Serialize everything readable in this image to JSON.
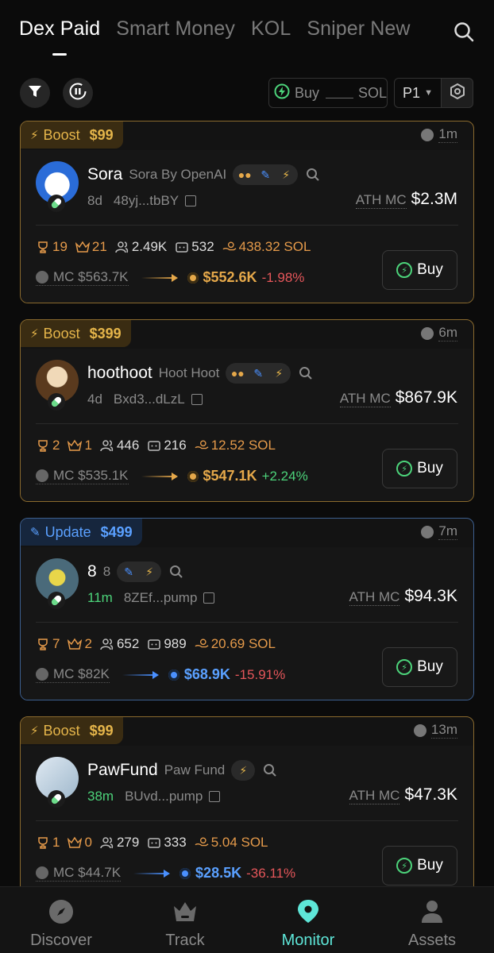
{
  "tabs": [
    {
      "label": "Dex Paid"
    },
    {
      "label": "Smart Money"
    },
    {
      "label": "KOL"
    },
    {
      "label": "Sniper New"
    }
  ],
  "toolbar": {
    "buy_label": "Buy",
    "sol_label": "SOL",
    "page_label": "P1"
  },
  "cards": [
    {
      "tag": "Boost",
      "tag_price": "$99",
      "age": "1m",
      "name": "Sora",
      "sub": "Sora By OpenAI",
      "token_age": "8d",
      "address": "48yj...tbBY",
      "ath_label": "ATH MC",
      "ath_value": "$2.3M",
      "stats": {
        "trophy": "19",
        "crown": "21",
        "holders": "2.49K",
        "bots": "532",
        "sol": "438.32 SOL"
      },
      "mc_label": "MC $563.7K",
      "mc_now": "$552.6K",
      "change": "-1.98%",
      "buy": "Buy"
    },
    {
      "tag": "Boost",
      "tag_price": "$399",
      "age": "6m",
      "name": "hoothoot",
      "sub": "Hoot Hoot",
      "token_age": "4d",
      "address": "Bxd3...dLzL",
      "ath_label": "ATH MC",
      "ath_value": "$867.9K",
      "stats": {
        "trophy": "2",
        "crown": "1",
        "holders": "446",
        "bots": "216",
        "sol": "12.52 SOL"
      },
      "mc_label": "MC $535.1K",
      "mc_now": "$547.1K",
      "change": "+2.24%",
      "buy": "Buy"
    },
    {
      "tag": "Update",
      "tag_price": "$499",
      "age": "7m",
      "name": "8",
      "sub": "8",
      "token_age": "11m",
      "address": "8ZEf...pump",
      "ath_label": "ATH MC",
      "ath_value": "$94.3K",
      "stats": {
        "trophy": "7",
        "crown": "2",
        "holders": "652",
        "bots": "989",
        "sol": "20.69 SOL"
      },
      "mc_label": "MC $82K",
      "mc_now": "$68.9K",
      "change": "-15.91%",
      "buy": "Buy"
    },
    {
      "tag": "Boost",
      "tag_price": "$99",
      "age": "13m",
      "name": "PawFund",
      "sub": "Paw Fund",
      "token_age": "38m",
      "address": "BUvd...pump",
      "ath_label": "ATH MC",
      "ath_value": "$47.3K",
      "stats": {
        "trophy": "1",
        "crown": "0",
        "holders": "279",
        "bots": "333",
        "sol": "5.04 SOL"
      },
      "mc_label": "MC $44.7K",
      "mc_now": "$28.5K",
      "change": "-36.11%",
      "buy": "Buy"
    }
  ],
  "bottom_nav": [
    {
      "label": "Discover",
      "icon": "compass-icon"
    },
    {
      "label": "Track",
      "icon": "crown-icon"
    },
    {
      "label": "Monitor",
      "icon": "location-pin-icon"
    },
    {
      "label": "Assets",
      "icon": "user-icon"
    }
  ],
  "colors": {
    "boost_border": "#8a6a2e",
    "update_border": "#3d5f8f",
    "gold": "#e5a84a",
    "blue": "#4a90ff",
    "green": "#4cd37a",
    "red": "#e5565a",
    "active_nav": "#5ee6d8"
  }
}
